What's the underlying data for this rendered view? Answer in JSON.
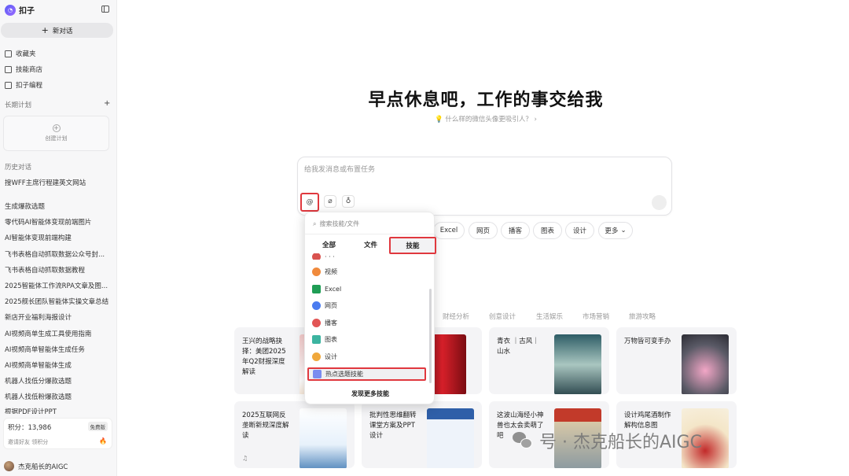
{
  "sidebar": {
    "brand": "扣子",
    "new_chat": "新对话",
    "nav": [
      {
        "label": "收藏夹"
      },
      {
        "label": "技能商店"
      },
      {
        "label": "扣子编程"
      }
    ],
    "plan_section": "长期计划",
    "plan_plus": "+",
    "create_plan": "创建计划",
    "history_section": "历史对话",
    "history": [
      "搜WFF主席行程建英文网站",
      "生成爆款选题",
      "零代码AI智能体变现前端图片",
      "AI智能体变现前端构建",
      "飞书表格自动抓取数据公众号封...",
      "飞书表格自动抓取数据教程",
      "2025智能体工作流RPA文章及图...",
      "2025舰长团队智能体实操文章总结",
      "新店开业福利海报设计",
      "AI视频商单生成工具使用指南",
      "AI视频商单智能体生成任务",
      "AI视频商单智能体生成",
      "机器人找低分爆款选题",
      "机器人找低粉爆款选题",
      "根据PDF设计PPT"
    ],
    "points_label": "积分：13,986",
    "points_badge": "免费版",
    "invite": "邀请好友 领积分",
    "user": "杰克船长的AIGC"
  },
  "main": {
    "title": "早点休息吧，工作的事交给我",
    "suggestion": "什么样的微信头像更吸引人？",
    "input_placeholder": "给我发消息或布置任务",
    "chips": [
      "Excel",
      "网页",
      "播客",
      "图表",
      "设计",
      "更多"
    ],
    "categories": [
      "财经分析",
      "创意设计",
      "生活娱乐",
      "市场营销",
      "旅游攻略"
    ],
    "cards": [
      {
        "text": "王兴的战略抉择：美团2025年Q2财报深度解读"
      },
      {
        "text": ""
      },
      {
        "text": "青衣 ｜古风｜山水"
      },
      {
        "text": "万物皆可变手办"
      },
      {
        "text": "2025互联网反垄断新规深度解读"
      },
      {
        "text": "批判性思维翻转课堂方案及PPT设计"
      },
      {
        "text": "这波山海经小神兽也太会卖萌了吧"
      },
      {
        "text": "设计鸡尾酒制作解构信息图"
      }
    ]
  },
  "popup": {
    "search_placeholder": "搜索技能/文件",
    "tabs": [
      "全部",
      "文件",
      "技能"
    ],
    "partial_item": "· · ·",
    "items": [
      {
        "label": "视频",
        "color": "#f08a3c"
      },
      {
        "label": "Excel",
        "color": "#1f9d55"
      },
      {
        "label": "网页",
        "color": "#4a7cf0"
      },
      {
        "label": "播客",
        "color": "#e25555"
      },
      {
        "label": "图表",
        "color": "#3cb4a0"
      },
      {
        "label": "设计",
        "color": "#f0a83c"
      },
      {
        "label": "热点选题技能",
        "color": "#7b8cf0"
      }
    ],
    "discover_more": "发现更多技能"
  },
  "watermark": {
    "text": "号 · 杰克船长的AIGC",
    "icon": "wechat-icon"
  },
  "colors": {
    "highlight_red": "#e0383e",
    "brand_purple": "#5b5cf6"
  }
}
